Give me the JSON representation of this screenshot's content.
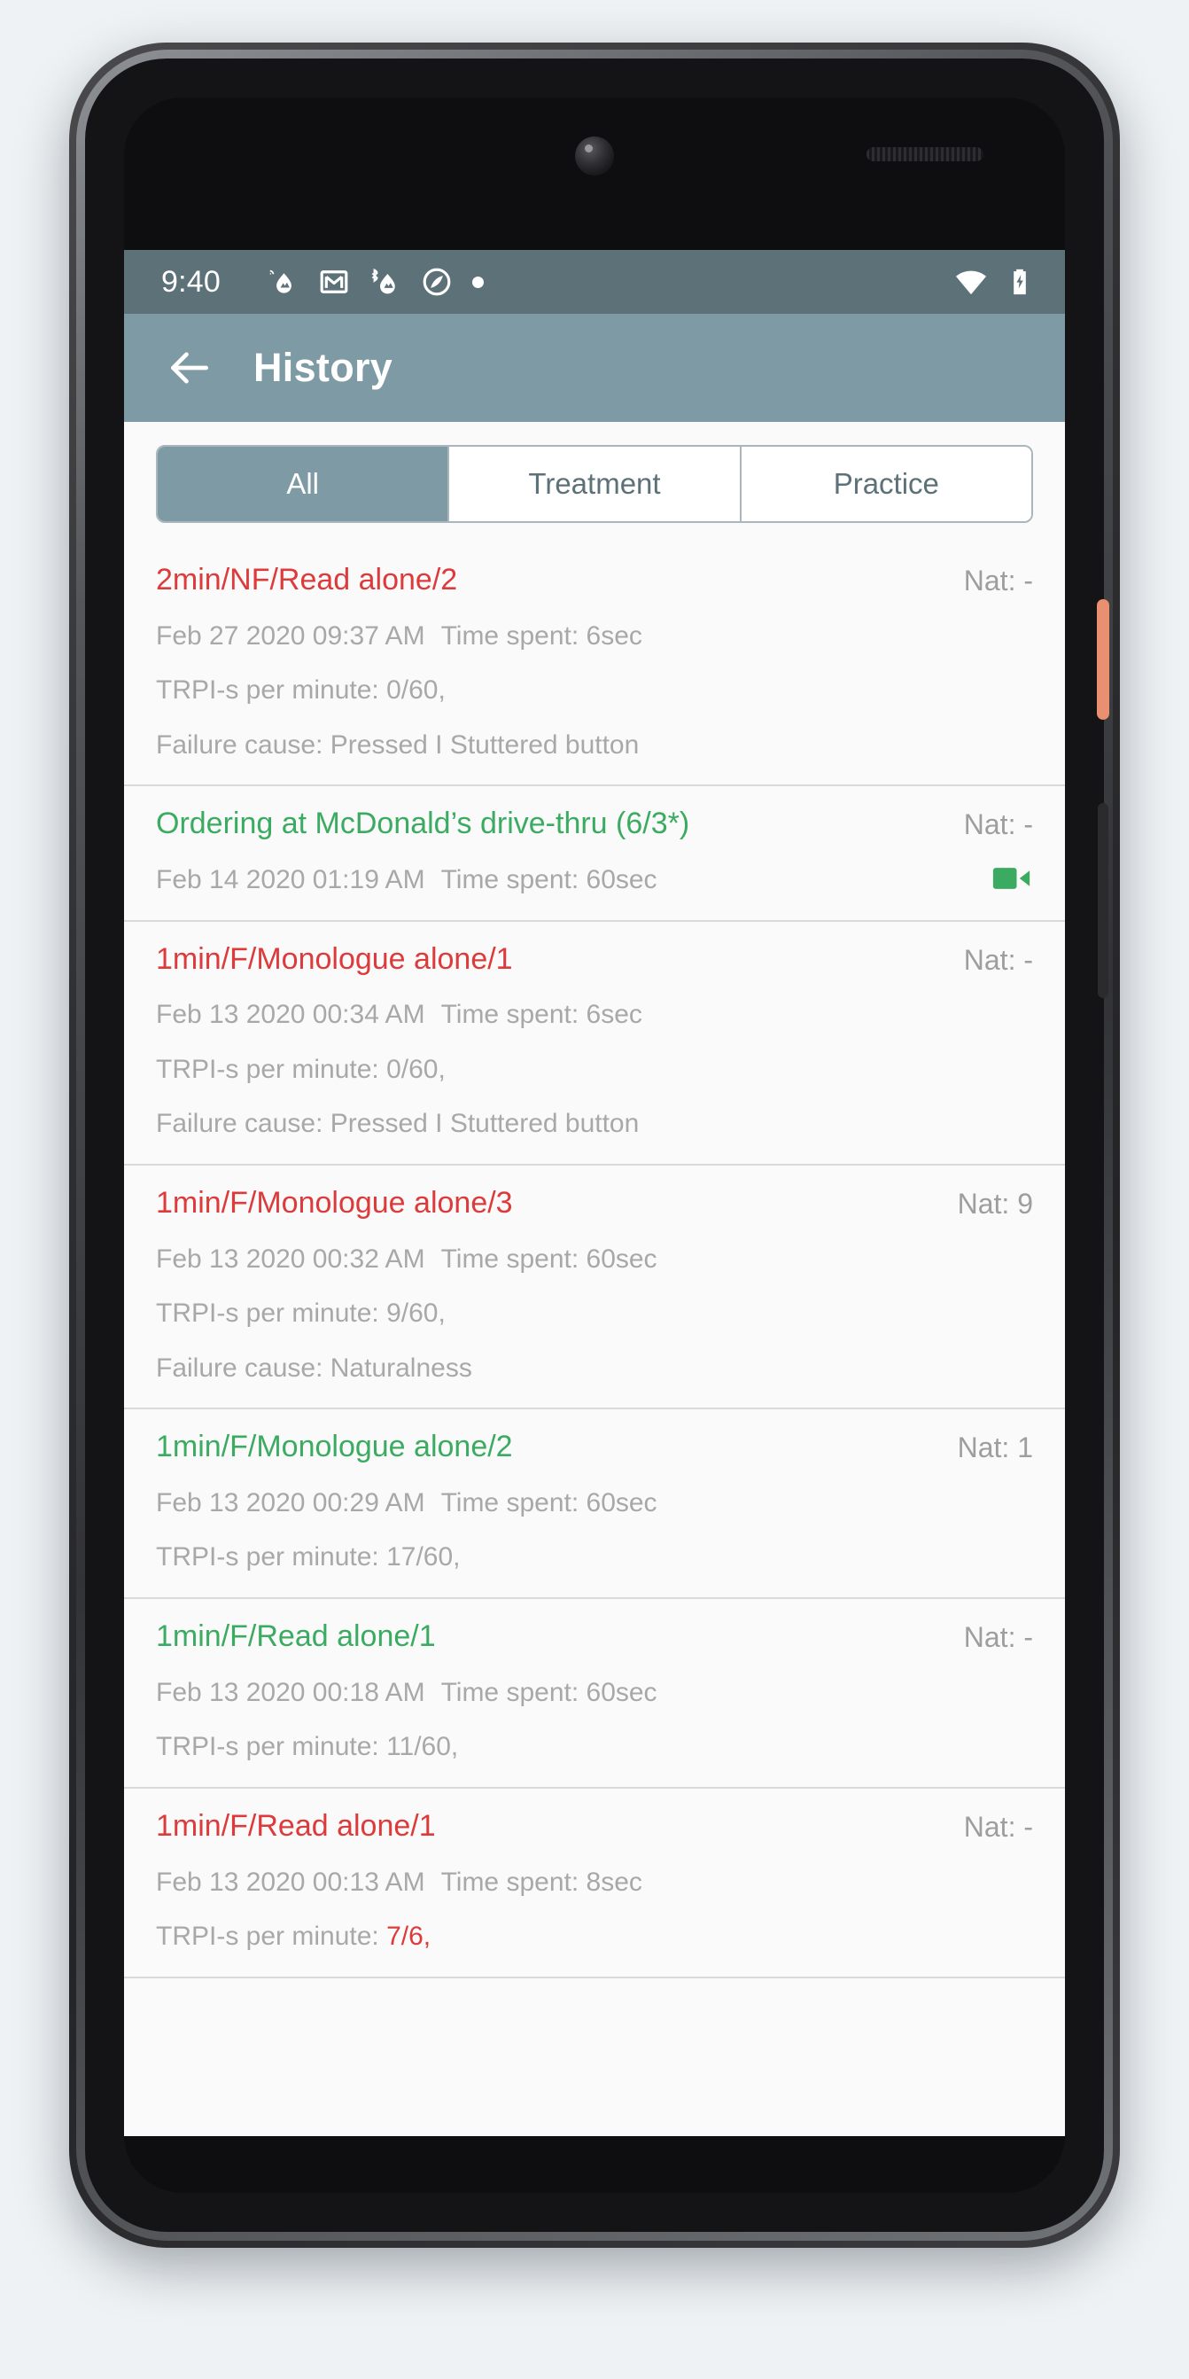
{
  "statusbar": {
    "time": "9:40",
    "left_icons": [
      "sync-drop-icon",
      "gmail-icon",
      "bluetooth-drop-icon",
      "android-auto-icon",
      "dot-icon"
    ],
    "right_icons": [
      "wifi-icon",
      "battery-charging-icon"
    ],
    "background": "#5d7179"
  },
  "appbar": {
    "back_label": "arrow-back-icon",
    "title": "History",
    "background": "#7e9aa4"
  },
  "tabs": {
    "selected_index": 0,
    "items": [
      {
        "label": "All"
      },
      {
        "label": "Treatment"
      },
      {
        "label": "Practice"
      }
    ]
  },
  "colors": {
    "fail": "#dd3b3b",
    "pass": "#3cab62",
    "muted": "#a8a8a8",
    "accent": "#7e9aa4"
  },
  "list": {
    "items": [
      {
        "title": "2min/NF/Read alone/2",
        "status": "fail",
        "nat": "Nat: -",
        "date": "Feb 27 2020 09:37 AM",
        "time_spent": "Time spent: 6sec",
        "trpi_label": "TRPI-s per minute: ",
        "trpi_value": "0/60,",
        "trpi_value_red": false,
        "failure": "Failure cause: Pressed I Stuttered button",
        "has_video": false
      },
      {
        "title": "Ordering at McDonald’s drive-thru (6/3*)",
        "status": "pass",
        "nat": "Nat: -",
        "date": "Feb 14 2020 01:19 AM",
        "time_spent": "Time spent: 60sec",
        "trpi_label": "",
        "trpi_value": "",
        "trpi_value_red": false,
        "failure": "",
        "has_video": true
      },
      {
        "title": "1min/F/Monologue alone/1",
        "status": "fail",
        "nat": "Nat: -",
        "date": "Feb 13 2020 00:34 AM",
        "time_spent": "Time spent: 6sec",
        "trpi_label": "TRPI-s per minute: ",
        "trpi_value": "0/60,",
        "trpi_value_red": false,
        "failure": "Failure cause: Pressed I Stuttered button",
        "has_video": false
      },
      {
        "title": "1min/F/Monologue alone/3",
        "status": "fail",
        "nat": "Nat: 9",
        "date": "Feb 13 2020 00:32 AM",
        "time_spent": "Time spent: 60sec",
        "trpi_label": "TRPI-s per minute: ",
        "trpi_value": "9/60,",
        "trpi_value_red": false,
        "failure": "Failure cause: Naturalness",
        "has_video": false
      },
      {
        "title": "1min/F/Monologue alone/2",
        "status": "pass",
        "nat": "Nat: 1",
        "date": "Feb 13 2020 00:29 AM",
        "time_spent": "Time spent: 60sec",
        "trpi_label": "TRPI-s per minute: ",
        "trpi_value": "17/60,",
        "trpi_value_red": false,
        "failure": "",
        "has_video": false
      },
      {
        "title": "1min/F/Read alone/1",
        "status": "pass",
        "nat": "Nat: -",
        "date": "Feb 13 2020 00:18 AM",
        "time_spent": "Time spent: 60sec",
        "trpi_label": "TRPI-s per minute: ",
        "trpi_value": "11/60,",
        "trpi_value_red": false,
        "failure": "",
        "has_video": false
      },
      {
        "title": "1min/F/Read alone/1",
        "status": "fail",
        "nat": "Nat: -",
        "date": "Feb 13 2020 00:13 AM",
        "time_spent": "Time spent: 8sec",
        "trpi_label": "TRPI-s per minute: ",
        "trpi_value": "7/6,",
        "trpi_value_red": true,
        "failure": "",
        "has_video": false
      }
    ]
  }
}
